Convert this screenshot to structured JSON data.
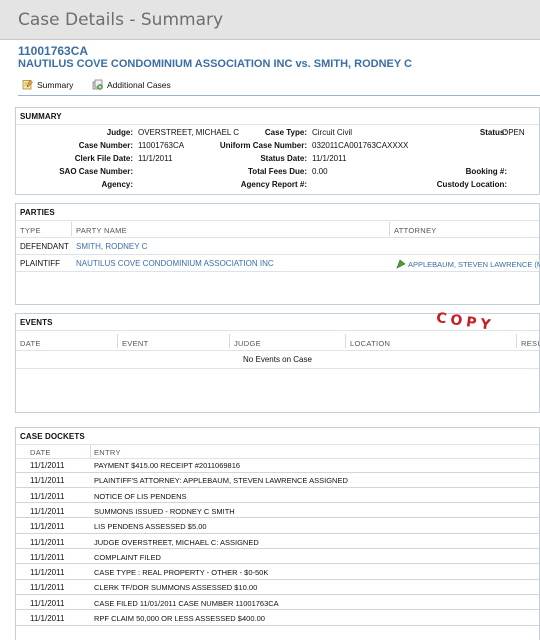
{
  "header": {
    "title": "Case Details - Summary"
  },
  "case": {
    "number": "11001763CA",
    "caption": "NAUTILUS COVE CONDOMINIUM ASSOCIATION INC vs. SMITH, RODNEY C"
  },
  "tabs": [
    {
      "label": "Summary",
      "icon": "summary-icon"
    },
    {
      "label": "Additional Cases",
      "icon": "additional-cases-icon"
    }
  ],
  "summary": {
    "title": "SUMMARY",
    "fields": {
      "judge": {
        "label": "Judge:",
        "value": "OVERSTREET, MICHAEL C"
      },
      "case_number": {
        "label": "Case Number:",
        "value": "11001763CA"
      },
      "clerk_file_date": {
        "label": "Clerk File Date:",
        "value": "11/1/2011"
      },
      "sao_case_number": {
        "label": "SAO Case Number:",
        "value": ""
      },
      "agency": {
        "label": "Agency:",
        "value": ""
      },
      "case_type": {
        "label": "Case Type:",
        "value": "Circuit Civil"
      },
      "uniform_case_number": {
        "label": "Uniform Case Number:",
        "value": "032011CA001763CAXXXX"
      },
      "status_date": {
        "label": "Status Date:",
        "value": "11/1/2011"
      },
      "total_fees_due": {
        "label": "Total Fees Due:",
        "value": "0.00"
      },
      "agency_report": {
        "label": "Agency Report #:",
        "value": ""
      },
      "status": {
        "label": "Status:",
        "value": "OPEN"
      },
      "booking": {
        "label": "Booking #:",
        "value": ""
      },
      "custody_location": {
        "label": "Custody Location:",
        "value": ""
      }
    }
  },
  "parties": {
    "title": "PARTIES",
    "columns": [
      "TYPE",
      "PARTY NAME",
      "ATTORNEY"
    ],
    "rows": [
      {
        "type": "DEFENDANT",
        "name": "SMITH, RODNEY C",
        "attorney": ""
      },
      {
        "type": "PLAINTIFF",
        "name": "NAUTILUS COVE CONDOMINIUM ASSOCIATION INC",
        "attorney": "APPLEBAUM, STEVEN LAWRENCE (M"
      }
    ]
  },
  "events": {
    "title": "EVENTS",
    "columns": [
      "DATE",
      "EVENT",
      "JUDGE",
      "LOCATION",
      "RESU"
    ],
    "empty_text": "No Events on Case"
  },
  "stamp": {
    "text": "COPY",
    "color": "#c71d26"
  },
  "dockets": {
    "title": "CASE DOCKETS",
    "columns": [
      "DATE",
      "ENTRY"
    ],
    "rows": [
      {
        "date": "11/1/2011",
        "entry": "PAYMENT $415.00 RECEIPT #2011069816"
      },
      {
        "date": "11/1/2011",
        "entry": "PLAINTIFF'S ATTORNEY: APPLEBAUM, STEVEN LAWRENCE ASSIGNED"
      },
      {
        "date": "11/1/2011",
        "entry": "NOTICE OF LIS PENDENS"
      },
      {
        "date": "11/1/2011",
        "entry": "SUMMONS ISSUED - RODNEY C SMITH"
      },
      {
        "date": "11/1/2011",
        "entry": "LIS PENDENS ASSESSED $5.00"
      },
      {
        "date": "11/1/2011",
        "entry": "JUDGE OVERSTREET, MICHAEL C: ASSIGNED"
      },
      {
        "date": "11/1/2011",
        "entry": "COMPLAINT FILED"
      },
      {
        "date": "11/1/2011",
        "entry": "CASE TYPE : REAL PROPERTY - OTHER - $0-50K"
      },
      {
        "date": "11/1/2011",
        "entry": "CLERK TF/DOR SUMMONS ASSESSED $10.00"
      },
      {
        "date": "11/1/2011",
        "entry": "CASE FILED 11/01/2011 CASE NUMBER 11001763CA"
      },
      {
        "date": "11/1/2011",
        "entry": "RPF CLAIM 50,000 OR LESS ASSESSED $400.00"
      }
    ]
  },
  "colors": {
    "link": "#3a6ea5",
    "header_bg": "#e4e4e4",
    "border": "#c4cfdc"
  }
}
